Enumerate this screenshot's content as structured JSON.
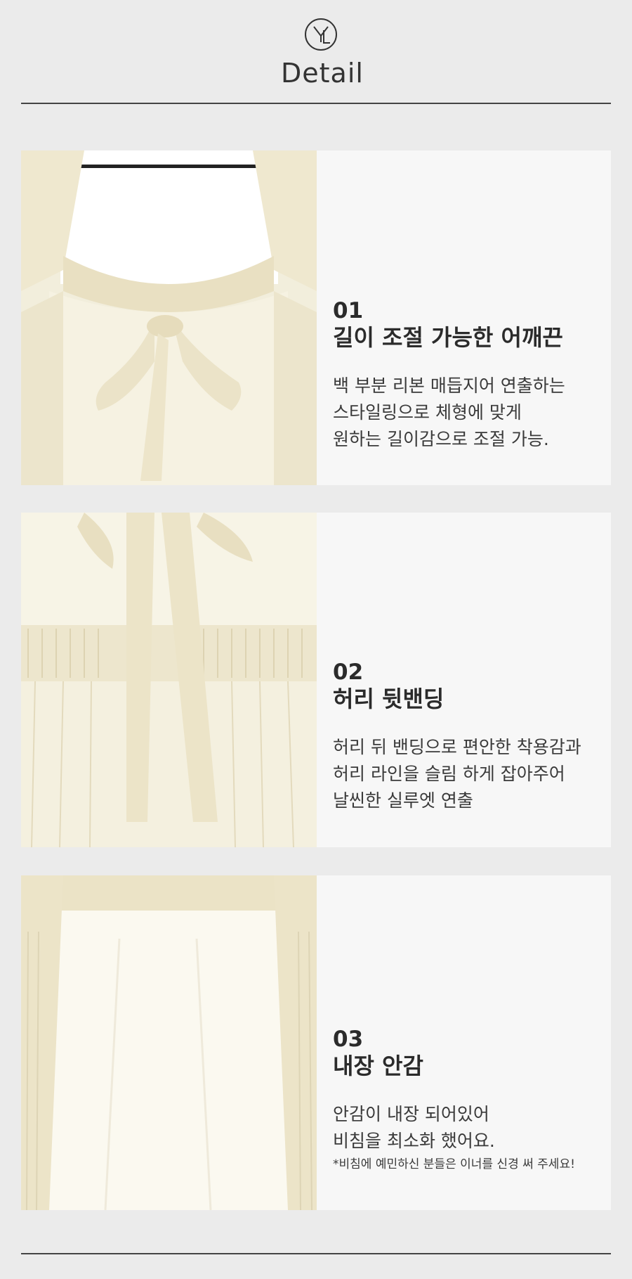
{
  "header": {
    "title": "Detail",
    "logo_label": "YL"
  },
  "sections": [
    {
      "number": "01",
      "heading": "길이 조절 가능한 어깨끈",
      "lines": [
        "백 부분 리본 매듭지어 연출하는",
        "스타일링으로 체형에 맞게",
        "원하는 길이감으로 조절 가능."
      ]
    },
    {
      "number": "02",
      "heading": "허리 뒷밴딩",
      "lines": [
        "허리 뒤 밴딩으로 편안한 착용감과",
        "허리 라인을 슬림 하게 잡아주어",
        "날씬한 실루엣 연출"
      ]
    },
    {
      "number": "03",
      "heading": "내장 안감",
      "lines": [
        "안감이 내장 되어있어",
        "비침을 최소화 했어요."
      ],
      "note": "*비침에 예민하신 분들은 이너를 신경 써 주세요!"
    }
  ],
  "colors": {
    "background": "#ebebeb",
    "panel": "#f7f7f7",
    "fabric": "#f1ecd9",
    "rule": "#444444",
    "text": "#2b2b2b"
  },
  "icons": {
    "logo": "yl-monogram-logo"
  }
}
